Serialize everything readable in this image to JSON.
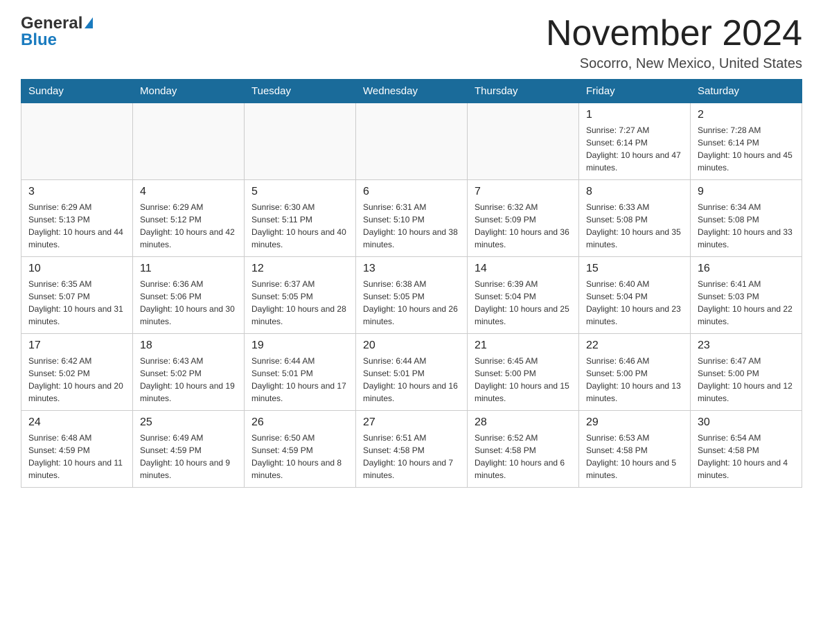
{
  "header": {
    "logo_general": "General",
    "logo_blue": "Blue",
    "month_title": "November 2024",
    "location": "Socorro, New Mexico, United States"
  },
  "weekdays": [
    "Sunday",
    "Monday",
    "Tuesday",
    "Wednesday",
    "Thursday",
    "Friday",
    "Saturday"
  ],
  "weeks": [
    [
      {
        "day": "",
        "info": ""
      },
      {
        "day": "",
        "info": ""
      },
      {
        "day": "",
        "info": ""
      },
      {
        "day": "",
        "info": ""
      },
      {
        "day": "",
        "info": ""
      },
      {
        "day": "1",
        "info": "Sunrise: 7:27 AM\nSunset: 6:14 PM\nDaylight: 10 hours and 47 minutes."
      },
      {
        "day": "2",
        "info": "Sunrise: 7:28 AM\nSunset: 6:14 PM\nDaylight: 10 hours and 45 minutes."
      }
    ],
    [
      {
        "day": "3",
        "info": "Sunrise: 6:29 AM\nSunset: 5:13 PM\nDaylight: 10 hours and 44 minutes."
      },
      {
        "day": "4",
        "info": "Sunrise: 6:29 AM\nSunset: 5:12 PM\nDaylight: 10 hours and 42 minutes."
      },
      {
        "day": "5",
        "info": "Sunrise: 6:30 AM\nSunset: 5:11 PM\nDaylight: 10 hours and 40 minutes."
      },
      {
        "day": "6",
        "info": "Sunrise: 6:31 AM\nSunset: 5:10 PM\nDaylight: 10 hours and 38 minutes."
      },
      {
        "day": "7",
        "info": "Sunrise: 6:32 AM\nSunset: 5:09 PM\nDaylight: 10 hours and 36 minutes."
      },
      {
        "day": "8",
        "info": "Sunrise: 6:33 AM\nSunset: 5:08 PM\nDaylight: 10 hours and 35 minutes."
      },
      {
        "day": "9",
        "info": "Sunrise: 6:34 AM\nSunset: 5:08 PM\nDaylight: 10 hours and 33 minutes."
      }
    ],
    [
      {
        "day": "10",
        "info": "Sunrise: 6:35 AM\nSunset: 5:07 PM\nDaylight: 10 hours and 31 minutes."
      },
      {
        "day": "11",
        "info": "Sunrise: 6:36 AM\nSunset: 5:06 PM\nDaylight: 10 hours and 30 minutes."
      },
      {
        "day": "12",
        "info": "Sunrise: 6:37 AM\nSunset: 5:05 PM\nDaylight: 10 hours and 28 minutes."
      },
      {
        "day": "13",
        "info": "Sunrise: 6:38 AM\nSunset: 5:05 PM\nDaylight: 10 hours and 26 minutes."
      },
      {
        "day": "14",
        "info": "Sunrise: 6:39 AM\nSunset: 5:04 PM\nDaylight: 10 hours and 25 minutes."
      },
      {
        "day": "15",
        "info": "Sunrise: 6:40 AM\nSunset: 5:04 PM\nDaylight: 10 hours and 23 minutes."
      },
      {
        "day": "16",
        "info": "Sunrise: 6:41 AM\nSunset: 5:03 PM\nDaylight: 10 hours and 22 minutes."
      }
    ],
    [
      {
        "day": "17",
        "info": "Sunrise: 6:42 AM\nSunset: 5:02 PM\nDaylight: 10 hours and 20 minutes."
      },
      {
        "day": "18",
        "info": "Sunrise: 6:43 AM\nSunset: 5:02 PM\nDaylight: 10 hours and 19 minutes."
      },
      {
        "day": "19",
        "info": "Sunrise: 6:44 AM\nSunset: 5:01 PM\nDaylight: 10 hours and 17 minutes."
      },
      {
        "day": "20",
        "info": "Sunrise: 6:44 AM\nSunset: 5:01 PM\nDaylight: 10 hours and 16 minutes."
      },
      {
        "day": "21",
        "info": "Sunrise: 6:45 AM\nSunset: 5:00 PM\nDaylight: 10 hours and 15 minutes."
      },
      {
        "day": "22",
        "info": "Sunrise: 6:46 AM\nSunset: 5:00 PM\nDaylight: 10 hours and 13 minutes."
      },
      {
        "day": "23",
        "info": "Sunrise: 6:47 AM\nSunset: 5:00 PM\nDaylight: 10 hours and 12 minutes."
      }
    ],
    [
      {
        "day": "24",
        "info": "Sunrise: 6:48 AM\nSunset: 4:59 PM\nDaylight: 10 hours and 11 minutes."
      },
      {
        "day": "25",
        "info": "Sunrise: 6:49 AM\nSunset: 4:59 PM\nDaylight: 10 hours and 9 minutes."
      },
      {
        "day": "26",
        "info": "Sunrise: 6:50 AM\nSunset: 4:59 PM\nDaylight: 10 hours and 8 minutes."
      },
      {
        "day": "27",
        "info": "Sunrise: 6:51 AM\nSunset: 4:58 PM\nDaylight: 10 hours and 7 minutes."
      },
      {
        "day": "28",
        "info": "Sunrise: 6:52 AM\nSunset: 4:58 PM\nDaylight: 10 hours and 6 minutes."
      },
      {
        "day": "29",
        "info": "Sunrise: 6:53 AM\nSunset: 4:58 PM\nDaylight: 10 hours and 5 minutes."
      },
      {
        "day": "30",
        "info": "Sunrise: 6:54 AM\nSunset: 4:58 PM\nDaylight: 10 hours and 4 minutes."
      }
    ]
  ]
}
